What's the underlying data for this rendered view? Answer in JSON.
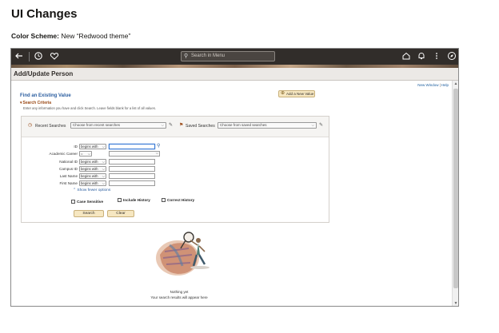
{
  "doc": {
    "title": "UI Changes",
    "scheme_label": "Color Scheme:",
    "scheme_value": " New “Redwood theme”"
  },
  "topbar": {
    "search_placeholder": "Search in Menu",
    "icons": [
      "back-arrow-icon",
      "history-icon",
      "favorites-heart-icon",
      "home-icon",
      "notification-bell-icon",
      "actions-kebab-icon",
      "navbar-compass-icon"
    ]
  },
  "page": {
    "title": "Add/Update Person",
    "links": {
      "new_window": "New Window",
      "help": "Help"
    }
  },
  "find": {
    "title": "Find an Existing Value",
    "criteria_title": "Search Criteria",
    "hint": "Enter any information you have and click Search. Leave fields blank for a list of all values.",
    "add_new": "Add a New Value"
  },
  "saved": {
    "recent_label": "Recent Searches",
    "recent_value": "Choose from recent searches",
    "saved_label": "Saved Searches",
    "saved_value": "Choose from saved searches"
  },
  "fields": [
    {
      "label": "ID",
      "op": "begins with"
    },
    {
      "label": "Academic Career",
      "op": "="
    },
    {
      "label": "National ID",
      "op": "begins with"
    },
    {
      "label": "Campus ID",
      "op": "begins with"
    },
    {
      "label": "Last Name",
      "op": "begins with"
    },
    {
      "label": "First Name",
      "op": "begins with"
    }
  ],
  "options": {
    "fewer": "Show fewer options",
    "case_sensitive": "Case Sensitive",
    "include_history": "Include History",
    "correct_history": "Correct History"
  },
  "buttons": {
    "search": "Search",
    "clear": "Clear"
  },
  "empty": {
    "line1": "Nothing yet",
    "line2": "Your search results will appear here"
  },
  "colors": {
    "topbar": "#312d2a",
    "accent_button": "#f6e7c1",
    "link": "#2a5d9f",
    "criteria": "#9b4a17"
  }
}
